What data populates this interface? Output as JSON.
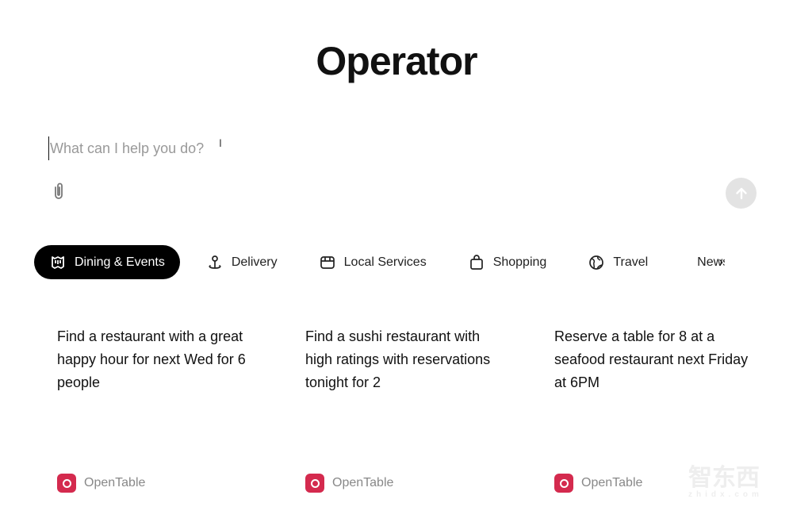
{
  "header": {
    "title": "Operator"
  },
  "composer": {
    "placeholder": "What can I help you do?",
    "value": ""
  },
  "tabs": [
    {
      "label": "Dining & Events",
      "icon": "dining-icon",
      "active": true
    },
    {
      "label": "Delivery",
      "icon": "delivery-pin-icon",
      "active": false
    },
    {
      "label": "Local Services",
      "icon": "storefront-icon",
      "active": false
    },
    {
      "label": "Shopping",
      "icon": "shopping-bag-icon",
      "active": false
    },
    {
      "label": "Travel",
      "icon": "globe-icon",
      "active": false
    },
    {
      "label": "News",
      "icon": "newspaper-icon",
      "active": false
    }
  ],
  "cards": [
    {
      "text": "Find a restaurant with a great happy hour for next Wed for 6 people",
      "source": "OpenTable"
    },
    {
      "text": "Find a sushi restaurant with high ratings with reservations tonight for 2",
      "source": "OpenTable"
    },
    {
      "text": "Reserve a table for 8 at a seafood restaurant next Friday at 6PM",
      "source": "OpenTable"
    }
  ],
  "watermark": {
    "text": "智东西",
    "sub": "zhidx.com"
  },
  "colors": {
    "active_tab": "#000000",
    "opentable": "#d42a4e",
    "send_disabled": "#e3e3e3"
  }
}
